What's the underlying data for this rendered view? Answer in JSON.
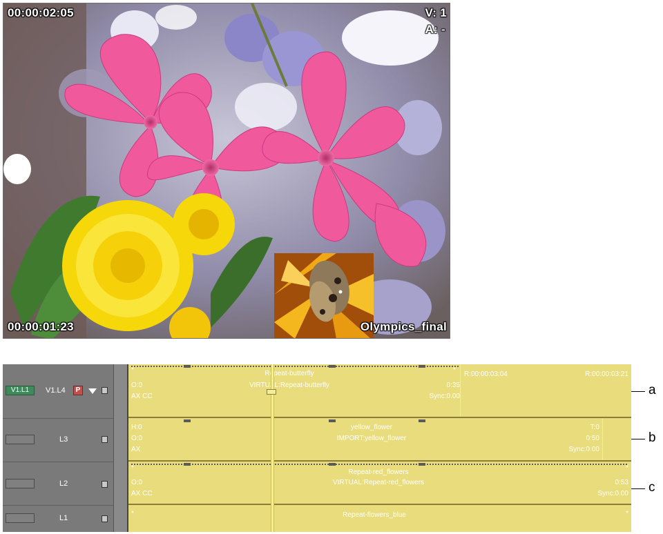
{
  "viewer": {
    "timecode_top": "00:00:02:05",
    "timecode_bottom": "00:00:01:23",
    "video_track": "V: 1",
    "audio_track": "A: -",
    "sequence_name": "Olympics_final"
  },
  "track_heads": {
    "v1_record": "V1.L1",
    "v1_source": "V1.L4",
    "priority_button": "P",
    "l3": "L3",
    "l2": "L2",
    "l1": "L1"
  },
  "tracks": {
    "l4": {
      "star_left": "*",
      "title": "Repeat-butterfly",
      "subtitle": "VIRTUAL:Repeat-butterfly",
      "left_line2": "O:0",
      "left_line3": "AX CC",
      "right_count": "0:35",
      "right_sync": "Sync:0.00",
      "star_right": "*",
      "next_tc_left": "R:00:00:03:04",
      "next_tc_right": "R:00:00:03:21"
    },
    "l3": {
      "left_line1": "H:0",
      "left_line2": "O:0",
      "left_line3": "AX",
      "title": "yellow_flower",
      "subtitle": "IMPORT:yellow_flower",
      "right_t": "T:0",
      "right_count": "0:50",
      "right_sync": "Sync:0.00"
    },
    "l2": {
      "star_left": "*",
      "title": "Repeat-red_flowers",
      "subtitle": "VIRTUAL:Repeat-red_flowers",
      "left_line2": "O:0",
      "left_line3": "AX CC",
      "right_count": "0:53",
      "right_sync": "Sync:0.00",
      "star_right": "*"
    },
    "l1": {
      "star_left": "*",
      "title": "Repeat-flowers_blue",
      "star_right": "*"
    }
  },
  "callouts": {
    "a": "a",
    "b": "b",
    "c": "c"
  }
}
